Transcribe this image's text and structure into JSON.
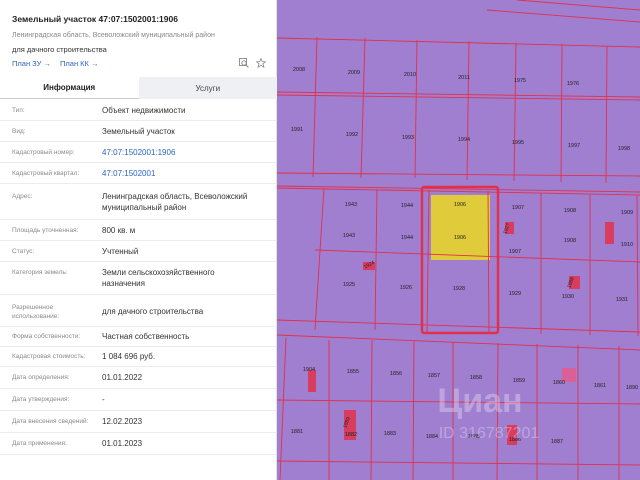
{
  "panel": {
    "title": "Земельный участок 47:07:1502001:1906",
    "subtitle": "Ленинградская область, Всеволожский муниципальный район",
    "purpose": "для дачного строительства",
    "link_zu": "План ЗУ →",
    "link_kk": "План КК →",
    "tabs": [
      "Информация",
      "Услуги"
    ],
    "rows": [
      {
        "label": "Тип:",
        "value": "Объект недвижимости"
      },
      {
        "label": "Вид:",
        "value": "Земельный участок"
      },
      {
        "label": "Кадастровый номер:",
        "value": "47:07:1502001:1906"
      },
      {
        "label": "Кадастровый квартал:",
        "value": "47:07:1502001"
      },
      {
        "label": "Адрес:",
        "value": "Ленинградская область, Всеволожский",
        "value2": "муниципальный район"
      },
      {
        "label": "Площадь уточненная:",
        "value": "800 кв. м"
      },
      {
        "label": "Статус:",
        "value": "Учтенный"
      },
      {
        "label": "Категория земель:",
        "value": "Земли сельскохозяйственного",
        "value2": "назначения"
      },
      {
        "label": "Разрешенное",
        "label2": "использование:",
        "value": "для дачного строительства"
      },
      {
        "label": "Форма собственности:",
        "value": "Частная собственность"
      },
      {
        "label": "Кадастровая стоимость:",
        "value": "1 084 696 руб."
      },
      {
        "label": "Дата определения:",
        "value": "01.01.2022"
      },
      {
        "label": "Дата утверждения:",
        "value": "-"
      },
      {
        "label": "Дата внесения сведений:",
        "value": "12.02.2023"
      },
      {
        "label": "Дата применения:",
        "value": "01.01.2023"
      }
    ]
  },
  "map": {
    "parcel_labels": {
      "r1": [
        "2008",
        "2009",
        "2010",
        "2011",
        "1975",
        "1976"
      ],
      "r2": [
        "1991",
        "1992",
        "1993",
        "1994",
        "1995",
        "1997",
        "1998"
      ],
      "r3a": [
        "1943",
        "1944",
        "1906",
        "1907",
        "1908",
        "1909"
      ],
      "r3b": [
        "1943",
        "1944",
        "1906",
        "1907",
        "1908",
        "1910"
      ],
      "r4": [
        "1925",
        "1926",
        "1928",
        "1929",
        "1930",
        "1931"
      ],
      "r5": [
        "1904",
        "1855",
        "1856",
        "1857",
        "1858",
        "1859",
        "1860",
        "1861"
      ],
      "r6": [
        "1881",
        "1882",
        "1883",
        "1884",
        "1885",
        "1886",
        "1887"
      ],
      "rotated": [
        "1924",
        "1927",
        "1888",
        "1889"
      ],
      "edge": "1890"
    },
    "watermark": "Циан",
    "watermark_id": "ID 316787201",
    "colors": {
      "parcel": "#a07fd1",
      "border": "#e0304a",
      "selected": "#e0cc3a",
      "highlight": "#e2304a",
      "lot_mark": "#e85a8a"
    }
  }
}
